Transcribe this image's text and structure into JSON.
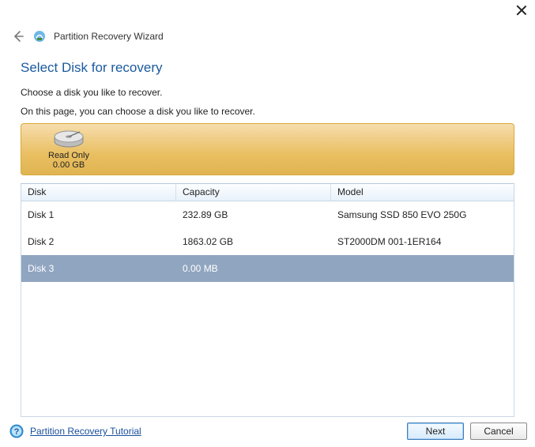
{
  "header": {
    "title": "Partition Recovery Wizard"
  },
  "page": {
    "heading": "Select Disk for recovery",
    "body_text": "Choose a disk you like to recover.",
    "sub_text": "On this page, you can choose a disk you like to recover."
  },
  "media": {
    "status_label": "Read Only",
    "size_label": "0.00 GB"
  },
  "table": {
    "columns": {
      "disk": "Disk",
      "capacity": "Capacity",
      "model": "Model"
    },
    "rows": [
      {
        "disk": "Disk 1",
        "capacity": "232.89 GB",
        "model": "Samsung SSD 850 EVO 250G",
        "selected": false
      },
      {
        "disk": "Disk 2",
        "capacity": "1863.02 GB",
        "model": "ST2000DM 001-1ER164",
        "selected": false
      },
      {
        "disk": "Disk 3",
        "capacity": "0.00 MB",
        "model": "",
        "selected": true
      }
    ]
  },
  "footer": {
    "tutorial_link": "Partition Recovery Tutorial",
    "next_label": "Next",
    "cancel_label": "Cancel"
  }
}
